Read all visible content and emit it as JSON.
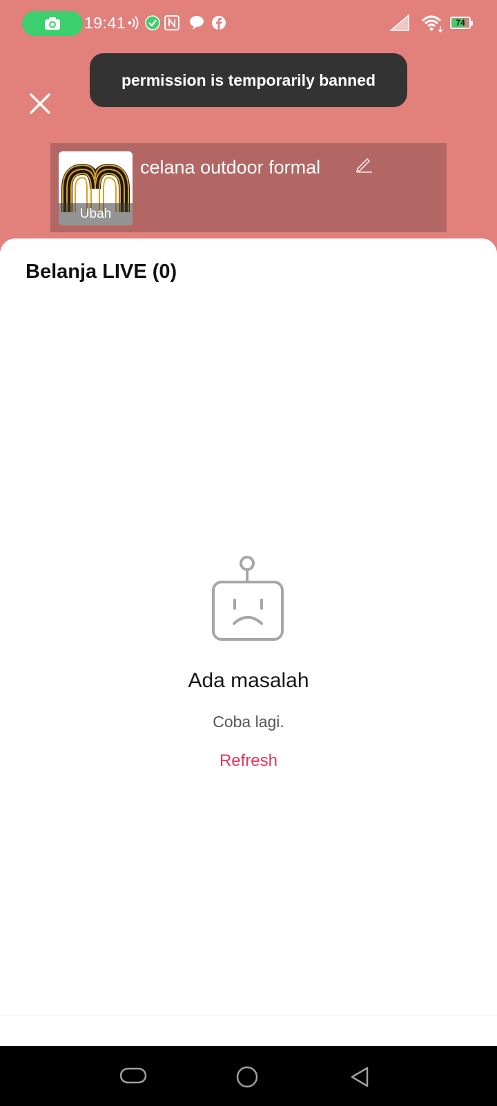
{
  "status_bar": {
    "time": "19:41",
    "battery": "74",
    "battery_level": 0.74,
    "icons": [
      "camera-icon",
      "vibrate-icon",
      "check-circle-icon",
      "nfc-icon",
      "chat-icon",
      "facebook-icon",
      "signal-icon",
      "wifi-icon",
      "battery-icon"
    ]
  },
  "toast": {
    "message": "permission is temporarily banned"
  },
  "product": {
    "title": "celana outdoor  formal",
    "thumb_label": "Ubah"
  },
  "sheet": {
    "title": "Belanja LIVE (0)"
  },
  "error": {
    "title": "Ada masalah",
    "subtitle": "Coba lagi.",
    "action_label": "Refresh"
  },
  "colors": {
    "background": "#e2807c",
    "accent": "#e2375d",
    "toast": "#333333",
    "status_pill": "#3ccf6e"
  }
}
